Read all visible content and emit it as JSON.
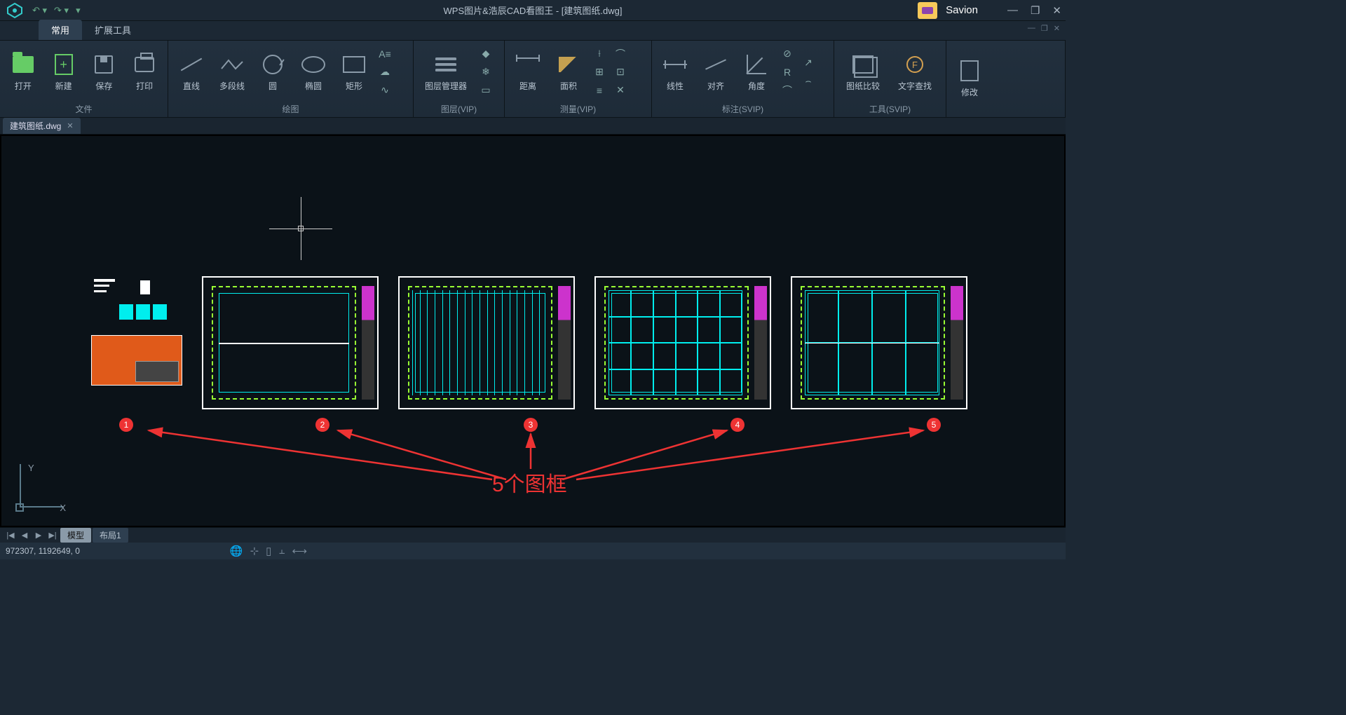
{
  "title": "WPS图片&浩辰CAD看图王 - [建筑图纸.dwg]",
  "user": "Savion",
  "qat": {
    "undo": "↶ ▾",
    "redo": "↷ ▾",
    "dd": "▾"
  },
  "winbtns": {
    "min": "—",
    "max": "❐",
    "close": "✕"
  },
  "subwin": {
    "min": "—",
    "max": "❐",
    "close": "✕"
  },
  "ribbonTabs": {
    "home": "常用",
    "ext": "扩展工具"
  },
  "groups": {
    "file": {
      "label": "文件",
      "open": "打开",
      "new": "新建",
      "save": "保存",
      "print": "打印"
    },
    "draw": {
      "label": "绘图",
      "line": "直线",
      "pline": "多段线",
      "circle": "圆",
      "ellipse": "椭圆",
      "rect": "矩形"
    },
    "layer": {
      "label": "图层(VIP)",
      "mgr": "图层管理器"
    },
    "measure": {
      "label": "测量(VIP)",
      "dist": "距离",
      "area": "面积"
    },
    "dim": {
      "label": "标注(SVIP)",
      "linear": "线性",
      "align": "对齐",
      "angle": "角度"
    },
    "tool": {
      "label": "工具(SVIP)",
      "compare": "图纸比较",
      "find": "文字查找"
    },
    "modify": {
      "label": "",
      "mod": "修改"
    }
  },
  "docTab": {
    "name": "建筑图纸.dwg",
    "close": "✕"
  },
  "ucs": {
    "y": "Y",
    "x": "X"
  },
  "layoutTabs": {
    "nav1": "|◀",
    "nav2": "◀",
    "nav3": "▶",
    "nav4": "▶|",
    "model": "模型",
    "layout1": "布局1"
  },
  "status": {
    "coords": "972307, 1192649, 0"
  },
  "annotation": {
    "text": "5个图框",
    "b1": "1",
    "b2": "2",
    "b3": "3",
    "b4": "4",
    "b5": "5"
  }
}
